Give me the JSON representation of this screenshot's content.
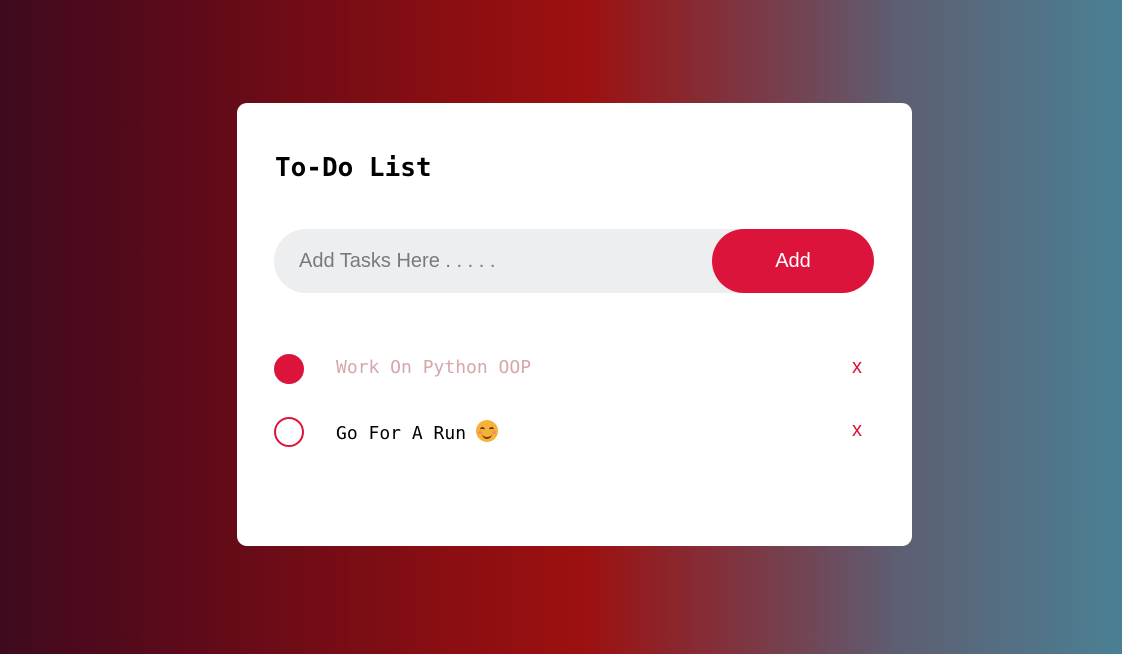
{
  "app": {
    "title": "To-Do List"
  },
  "input": {
    "placeholder": "Add Tasks Here . . . . .",
    "value": ""
  },
  "add_button": {
    "label": "Add"
  },
  "tasks": [
    {
      "text": "Work On Python OOP",
      "completed": true,
      "delete_label": "x"
    },
    {
      "text": "Go For A Run",
      "completed": false,
      "icon": "smiling-face-icon",
      "delete_label": "x"
    }
  ],
  "colors": {
    "accent": "#dc143c",
    "completed_text": "#d5a6aa",
    "input_bg": "#edeef0"
  }
}
